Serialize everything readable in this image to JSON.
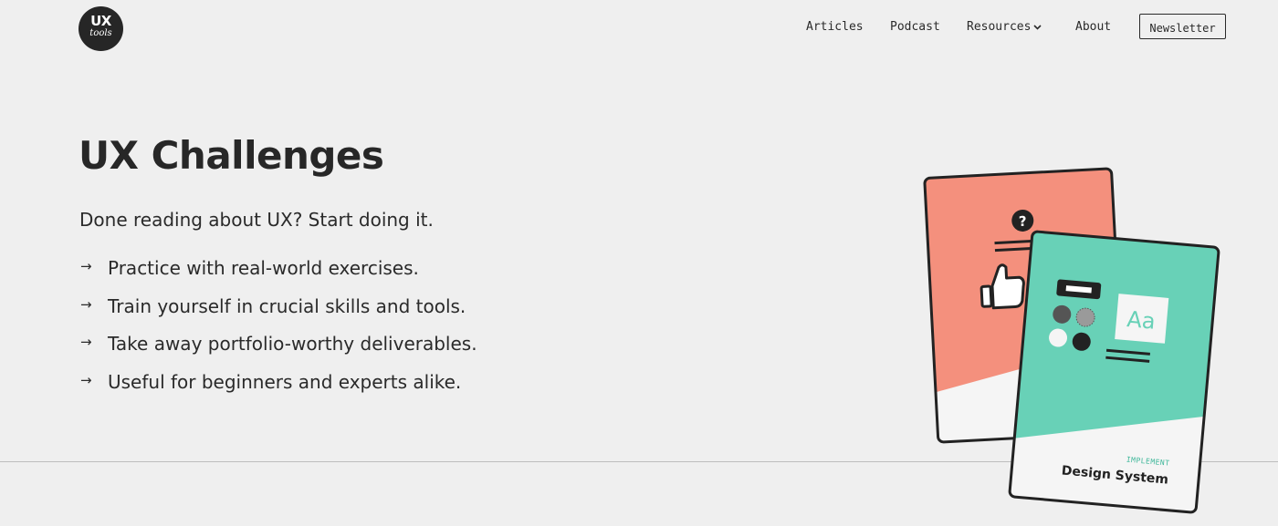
{
  "logo": {
    "line1": "UX",
    "line2": "tools"
  },
  "nav": {
    "items": [
      "Articles",
      "Podcast",
      "Resources",
      "About"
    ],
    "newsletter": "Newsletter"
  },
  "hero": {
    "title": "UX Challenges",
    "subtitle": "Done reading about UX? Start doing it.",
    "bullets": [
      "Practice with real-world exercises.",
      "Train yourself in crucial skills and tools.",
      "Take away portfolio-worthy deliverables.",
      "Useful for beginners and experts alike."
    ],
    "arrow_glyph": "→"
  },
  "card": {
    "tag": "IMPLEMENT",
    "title": "Design System",
    "sample_text": "Aa",
    "question_mark": "?"
  },
  "colors": {
    "background": "#efefef",
    "text": "#2a2a2a",
    "card_red": "#f4907d",
    "card_teal": "#68d1b7",
    "logo_bg": "#262626"
  }
}
